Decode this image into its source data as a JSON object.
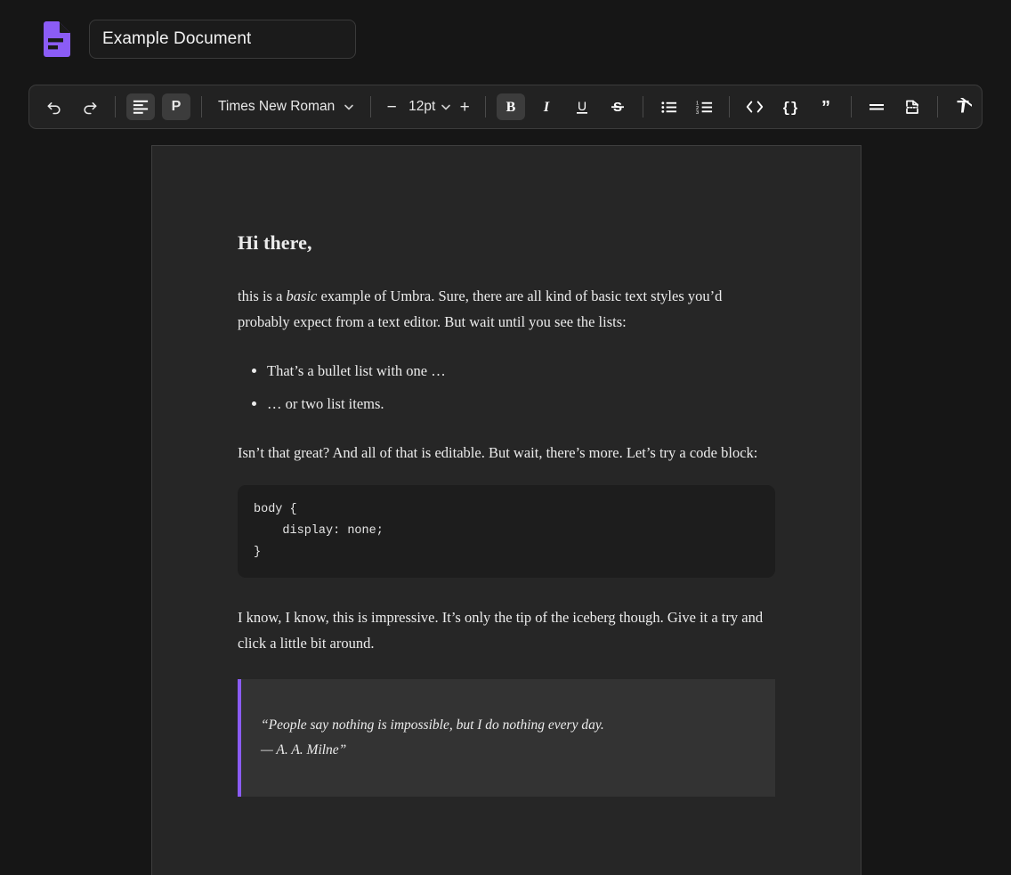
{
  "app": {
    "logo_icon": "document-icon",
    "accent_color": "#8b5cf6",
    "page_background": "#262626",
    "canvas_background": "#161616"
  },
  "header": {
    "title_value": "Example Document",
    "title_placeholder": "Untitled Document"
  },
  "toolbar": {
    "undo": {
      "icon": "undo-icon",
      "label": "Undo",
      "active": false
    },
    "redo": {
      "icon": "redo-icon",
      "label": "Redo",
      "active": false
    },
    "align": {
      "icon": "align-left-icon",
      "label": "Align left",
      "active": true
    },
    "paragraph": {
      "icon": "paragraph-style-icon",
      "label": "P",
      "active": true
    },
    "font_family": {
      "value": "Times New Roman",
      "chevron": "chevron-down-icon"
    },
    "font_size": {
      "decrease": "−",
      "value": "12pt",
      "chevron": "chevron-down-icon",
      "increase": "+"
    },
    "bold": {
      "icon": "bold-icon",
      "label": "B",
      "active": true
    },
    "italic": {
      "icon": "italic-icon",
      "label": "I",
      "active": false
    },
    "underline": {
      "icon": "underline-icon",
      "label": "U",
      "active": false
    },
    "strikethrough": {
      "icon": "strikethrough-icon",
      "label": "S",
      "active": false
    },
    "bullet_list": {
      "icon": "bullet-list-icon",
      "active": false
    },
    "ordered_list": {
      "icon": "ordered-list-icon",
      "active": false
    },
    "inline_code": {
      "icon": "code-icon",
      "label": "<>",
      "active": false
    },
    "code_block": {
      "icon": "code-block-icon",
      "label": "{}",
      "active": false
    },
    "blockquote": {
      "icon": "quote-icon",
      "label": "”",
      "active": false
    },
    "horizontal_rule": {
      "icon": "horizontal-rule-icon",
      "active": false
    },
    "page_break": {
      "icon": "page-break-icon",
      "active": false
    },
    "clear_format": {
      "icon": "clear-format-icon",
      "active": false
    }
  },
  "document": {
    "heading": "Hi there,",
    "intro_before": "this is a ",
    "intro_emphasis": "basic",
    "intro_after": " example of Umbra. Sure, there are all kind of basic text styles you’d probably expect from a text editor. But wait until you see the lists:",
    "bullets": [
      "That’s a bullet list with one …",
      "… or two list items."
    ],
    "after_list": "Isn’t that great? And all of that is editable. But wait, there’s more. Let’s try a code block:",
    "code": "body {\n    display: none;\n}",
    "after_code": "I know, I know, this is impressive. It’s only the tip of the iceberg though. Give it a try and click a little bit around.",
    "quote_line1": "“People say nothing is impossible, but I do nothing every day.",
    "quote_line2": "— A. A. Milne”"
  }
}
